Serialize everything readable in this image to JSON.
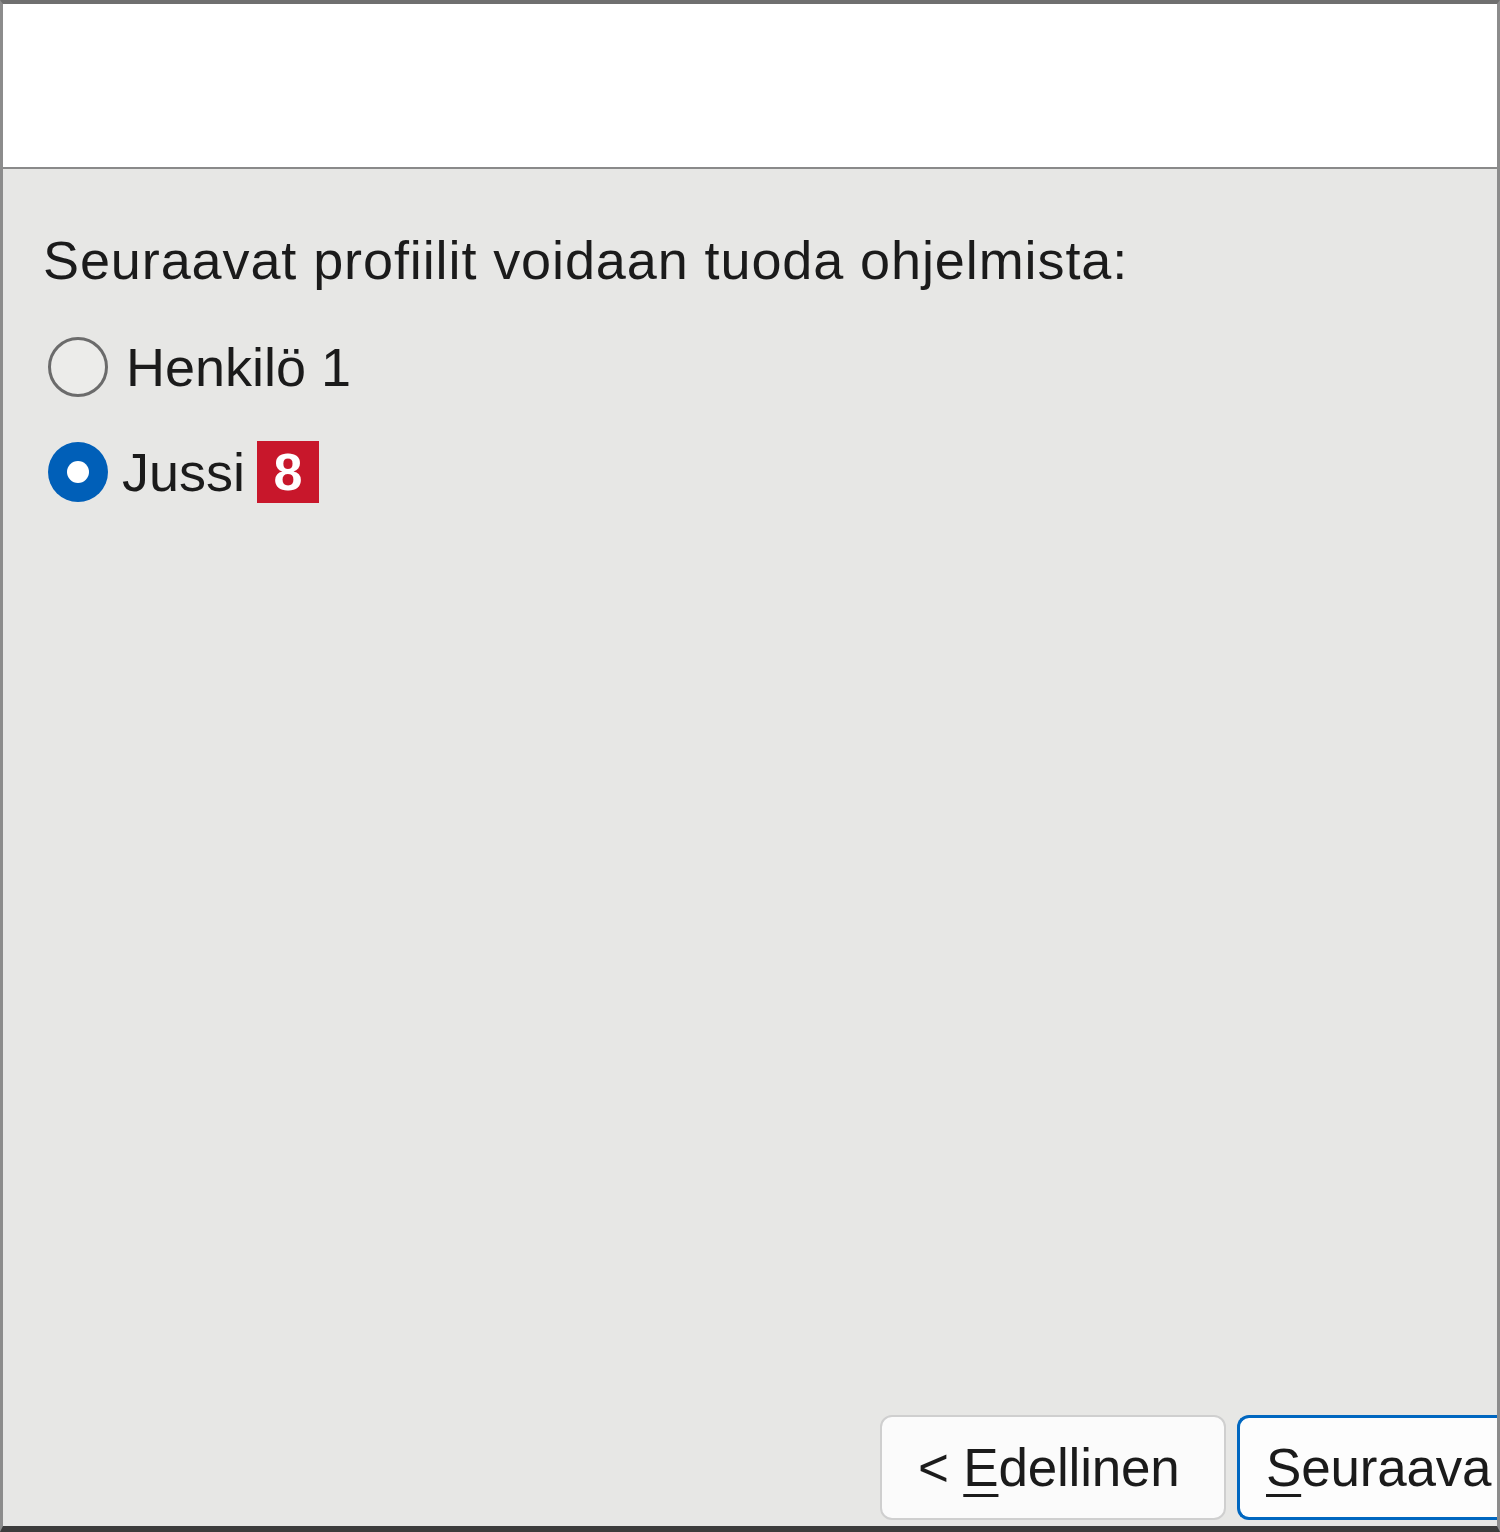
{
  "prompt": "Seuraavat profiilit voidaan tuoda ohjelmista:",
  "profiles": [
    {
      "label": "Henkilö 1",
      "selected": false
    },
    {
      "label": "Jussi",
      "selected": true,
      "badge": "8"
    }
  ],
  "buttons": [
    {
      "label": "< Edellinen",
      "kind": "secondary",
      "access_key_underlined": true
    },
    {
      "label": "Seuraava",
      "kind": "primary",
      "access_key_underlined": true
    }
  ]
}
